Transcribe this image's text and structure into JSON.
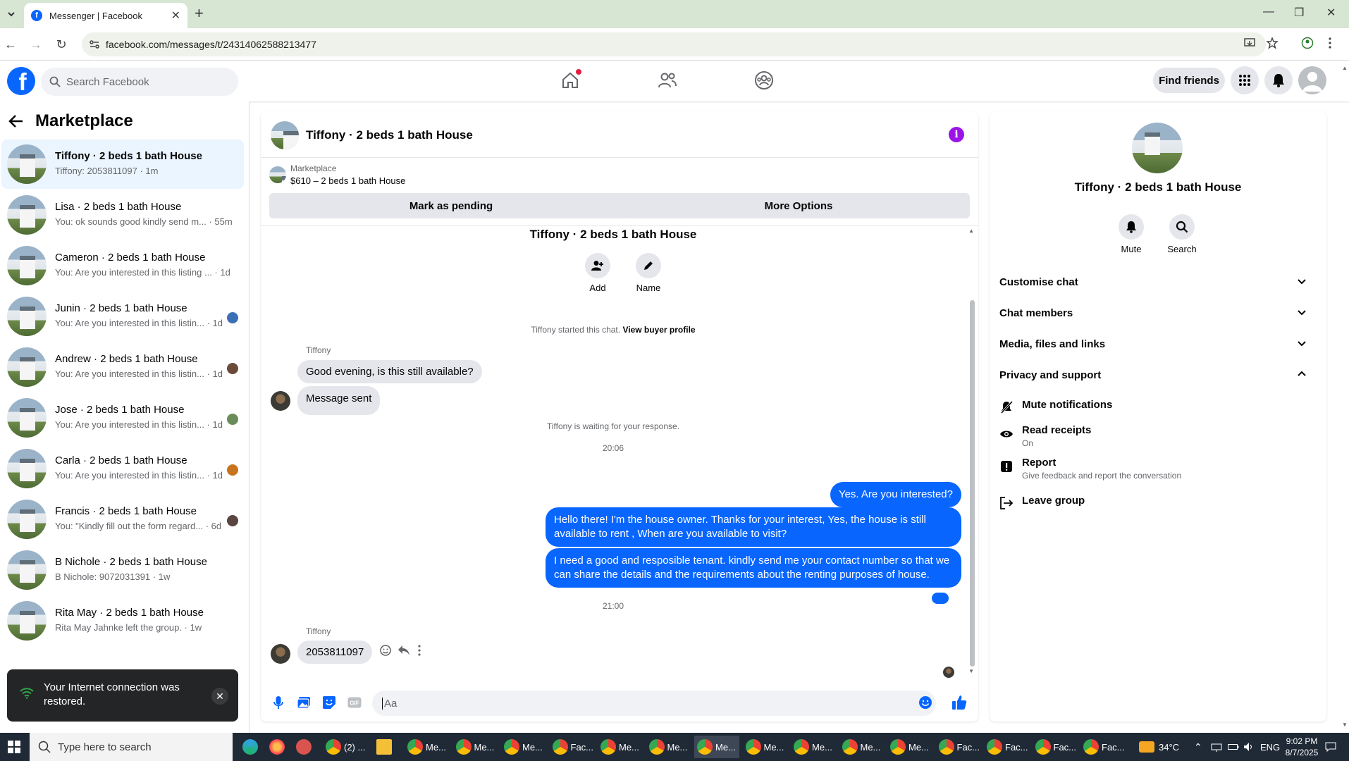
{
  "browser": {
    "tab_title": "Messenger | Facebook",
    "url": "facebook.com/messages/t/24314062588213477"
  },
  "fb": {
    "search_placeholder": "Search Facebook",
    "find_friends": "Find friends"
  },
  "sidebar": {
    "title": "Marketplace",
    "conversations": [
      {
        "name": "Tiffony · 2 beds 1 bath House",
        "preview": "Tiffony: 2053811097 · 1m",
        "active": true
      },
      {
        "name": "Lisa · 2 beds 1 bath House",
        "preview": "You: ok sounds good kindly send m... · 55m"
      },
      {
        "name": "Cameron · 2 beds 1 bath House",
        "preview": "You: Are you interested in this listing ... · 1d"
      },
      {
        "name": "Junin · 2 beds 1 bath House",
        "preview": "You: Are you interested in this listin... · 1d"
      },
      {
        "name": "Andrew · 2 beds 1 bath House",
        "preview": "You: Are you interested in this listin... · 1d"
      },
      {
        "name": "Jose · 2 beds 1 bath House",
        "preview": "You: Are you interested in this listin... · 1d"
      },
      {
        "name": "Carla · 2 beds 1 bath House",
        "preview": "You: Are you interested in this listin... · 1d"
      },
      {
        "name": "Francis · 2 beds 1 bath House",
        "preview": "You: \"Kindly fill out the form regard... · 6d"
      },
      {
        "name": "B Nichole · 2 beds 1 bath House",
        "preview": "B Nichole: 9072031391 · 1w"
      },
      {
        "name": "Rita May · 2 beds 1 bath House",
        "preview": "Rita May Jahnke left the group. · 1w"
      }
    ]
  },
  "toast": {
    "text": "Your Internet connection was restored."
  },
  "chat": {
    "header_name": "Tiffony · 2 beds 1 bath House",
    "marketplace_label": "Marketplace",
    "listing": "$610 – 2 beds 1 bath House",
    "mark_pending": "Mark as pending",
    "more_options": "More Options",
    "center_title": "Tiffony · 2 beds 1 bath House",
    "add_label": "Add",
    "name_label": "Name",
    "started_text": "Tiffony started this chat.",
    "view_buyer": "View buyer profile",
    "sender_name": "Tiffony",
    "msg1": "Good evening, is this still available?",
    "msg2": "Message sent",
    "waiting": "Tiffony is waiting for your response.",
    "time1": "20:06",
    "out1": "Yes. Are you interested?",
    "out2": "Hello there! I'm the house owner. Thanks for your interest, Yes, the house is still available to rent , When are you available to visit?",
    "out3": "I need a good and resposible tenant.  kindly send me your contact number so that we can share the details and the requirements about the renting purposes of house.",
    "time2": "21:00",
    "sender_name2": "Tiffony",
    "msg3": "2053811097",
    "composer_placeholder": "Aa"
  },
  "info": {
    "name": "Tiffony · 2 beds 1 bath House",
    "mute": "Mute",
    "search": "Search",
    "sections": [
      "Customise chat",
      "Chat members",
      "Media, files and links",
      "Privacy and support"
    ],
    "privacy_items": [
      {
        "label": "Mute notifications",
        "sub": ""
      },
      {
        "label": "Read receipts",
        "sub": "On"
      },
      {
        "label": "Report",
        "sub": "Give feedback and report the conversation"
      },
      {
        "label": "Leave group",
        "sub": ""
      }
    ]
  },
  "taskbar": {
    "search_placeholder": "Type here to search",
    "apps": [
      "(2) ...",
      "Me...",
      "Me...",
      "Me...",
      "Fac...",
      "Me...",
      "Me...",
      "Me...",
      "Me...",
      "Me...",
      "Me...",
      "Me...",
      "Fac...",
      "Fac...",
      "Fac...",
      "Fac..."
    ],
    "weather": "34°C",
    "lang": "ENG",
    "time": "9:02 PM",
    "date": "8/7/2025"
  },
  "colors": {
    "brand_blue": "#0866ff",
    "bubble_gray": "#e4e6eb",
    "info_purple": "#9b14e6"
  }
}
